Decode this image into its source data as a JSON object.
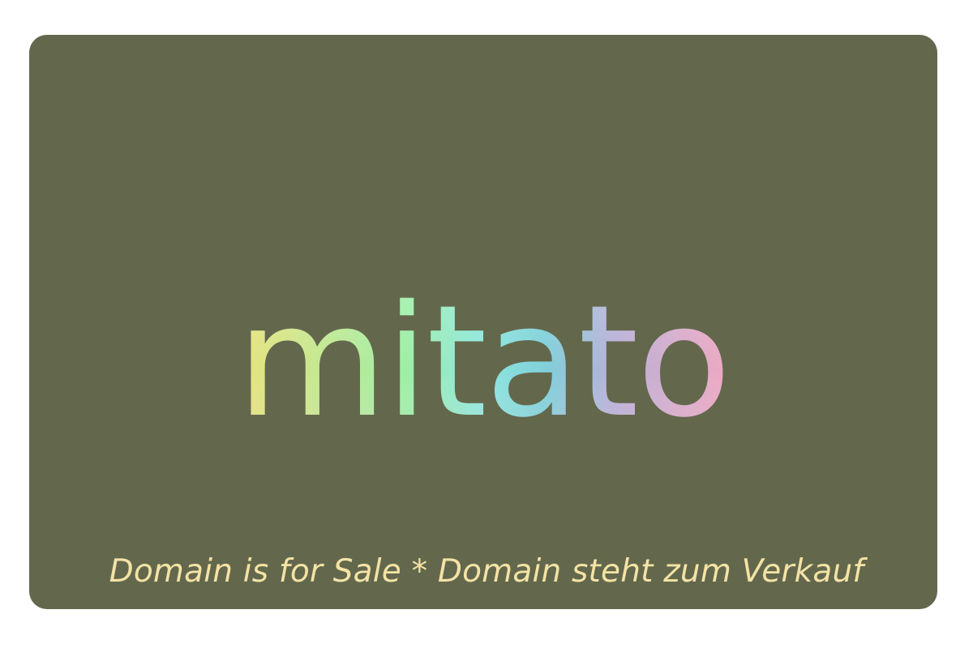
{
  "brand": {
    "name": "mitato"
  },
  "sale_notice": "Domain is for Sale * Domain steht zum Verkauf",
  "colors": {
    "card_background": "#63684d",
    "page_background": "#ffffff",
    "sale_text": "#f4e3a5",
    "logo_gradient_yellow": "#e4e37e",
    "logo_gradient_green": "#9ceea8",
    "logo_gradient_cyan": "#8ee7de",
    "logo_gradient_teal": "#7fd0d9",
    "logo_gradient_lavender": "#b7b1d8",
    "logo_gradient_pink": "#eda8c2"
  }
}
